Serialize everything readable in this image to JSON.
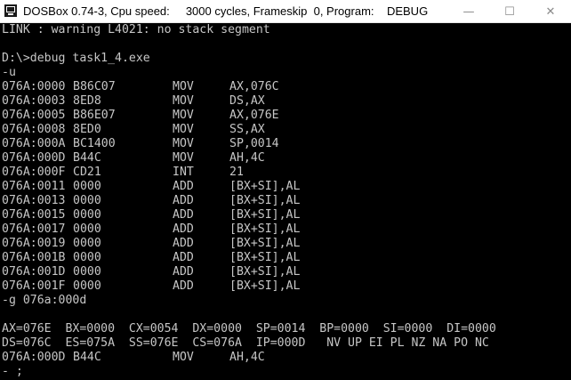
{
  "window": {
    "title": "DOSBox 0.74-3, Cpu speed:     3000 cycles, Frameskip  0, Program:    DEBUG",
    "minimize_glyph": "—",
    "maximize_glyph": "☐",
    "close_glyph": "✕",
    "icon": "dosbox-icon"
  },
  "console": {
    "header_lines": [
      "LINK : warning L4021: no stack segment",
      "",
      "D:\\>debug task1_4.exe",
      "-u"
    ],
    "disassembly": [
      {
        "addr": "076A:0000",
        "bytes": "B86C07",
        "op": "MOV",
        "args": "AX,076C"
      },
      {
        "addr": "076A:0003",
        "bytes": "8ED8",
        "op": "MOV",
        "args": "DS,AX"
      },
      {
        "addr": "076A:0005",
        "bytes": "B86E07",
        "op": "MOV",
        "args": "AX,076E"
      },
      {
        "addr": "076A:0008",
        "bytes": "8ED0",
        "op": "MOV",
        "args": "SS,AX"
      },
      {
        "addr": "076A:000A",
        "bytes": "BC1400",
        "op": "MOV",
        "args": "SP,0014"
      },
      {
        "addr": "076A:000D",
        "bytes": "B44C",
        "op": "MOV",
        "args": "AH,4C"
      },
      {
        "addr": "076A:000F",
        "bytes": "CD21",
        "op": "INT",
        "args": "21"
      },
      {
        "addr": "076A:0011",
        "bytes": "0000",
        "op": "ADD",
        "args": "[BX+SI],AL"
      },
      {
        "addr": "076A:0013",
        "bytes": "0000",
        "op": "ADD",
        "args": "[BX+SI],AL"
      },
      {
        "addr": "076A:0015",
        "bytes": "0000",
        "op": "ADD",
        "args": "[BX+SI],AL"
      },
      {
        "addr": "076A:0017",
        "bytes": "0000",
        "op": "ADD",
        "args": "[BX+SI],AL"
      },
      {
        "addr": "076A:0019",
        "bytes": "0000",
        "op": "ADD",
        "args": "[BX+SI],AL"
      },
      {
        "addr": "076A:001B",
        "bytes": "0000",
        "op": "ADD",
        "args": "[BX+SI],AL"
      },
      {
        "addr": "076A:001D",
        "bytes": "0000",
        "op": "ADD",
        "args": "[BX+SI],AL"
      },
      {
        "addr": "076A:001F",
        "bytes": "0000",
        "op": "ADD",
        "args": "[BX+SI],AL"
      }
    ],
    "go_command": "-g 076a:000d",
    "registers_line1": "AX=076E  BX=0000  CX=0054  DX=0000  SP=0014  BP=0000  SI=0000  DI=0000",
    "registers_line2": "DS=076C  ES=075A  SS=076E  CS=076A  IP=000D   NV UP EI PL NZ NA PO NC",
    "current_instruction": {
      "addr": "076A:000D",
      "bytes": "B44C",
      "op": "MOV",
      "args": "AH,4C"
    },
    "prompt": "- ;",
    "text_color": "#c6c6c6",
    "background_color": "#000000"
  }
}
